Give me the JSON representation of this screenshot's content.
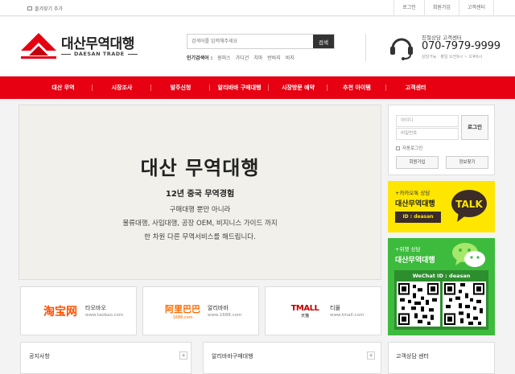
{
  "topbar": {
    "favorite": "즐겨찾기 추가",
    "links": [
      "로그인",
      "회원가입",
      "고객센터"
    ]
  },
  "logo": {
    "name": "대산무역대행",
    "sub": "DAESAN TRADE"
  },
  "search": {
    "placeholder": "검색어를 입력해주세요",
    "button": "검색",
    "popular_label": "인기검색어 :",
    "popular": [
      "원피스",
      "가디건",
      "치마",
      "반바지",
      "바지"
    ]
  },
  "cs": {
    "title": "친절상담 고객센터",
    "phone": "070-7979-9999",
    "hours": "상담가능 : 평일 오전9시 ~ 오후6시"
  },
  "nav": [
    "대산 무역",
    "시장조사",
    "발주신청",
    "알리바바 구매대행",
    "시장방문 예약",
    "추천 아이템",
    "고객센터"
  ],
  "hero": {
    "title": "대산 무역대행",
    "years": "12년 중국 무역경험",
    "line1": "구매대행 뿐만 아니라",
    "line2": "물류대행, 사입대행, 공장 OEM, 비지니스 가이드 까지",
    "line3": "한 차원 다른 무역서비스를 해드립니다."
  },
  "login": {
    "id_placeholder": "아이디",
    "pw_placeholder": "비밀번호",
    "login_button": "로그인",
    "auto_login": "자동로그인",
    "join": "회원가입",
    "find": "정보찾기"
  },
  "kakao": {
    "label": "+카카오톡 상담",
    "title": "대산무역대행",
    "id": "ID : deasan",
    "bubble": "TALK"
  },
  "wechat": {
    "label": "+위챗 상담",
    "title": "대산무역대행",
    "id": "WeChat ID : deasan"
  },
  "partners": [
    {
      "logo": "淘宝网",
      "name": "타오바오",
      "url": "www.taobao.com"
    },
    {
      "logo": "阿里巴巴",
      "logo_sub": "1688.com",
      "name": "알리바바",
      "url": "www.1688.com"
    },
    {
      "logo": "TMALL",
      "logo_sub": "天猫",
      "name": "티몰",
      "url": "www.tmall.com"
    }
  ],
  "boards": {
    "notice": "공지사항",
    "alibaba": "알리바바구매대행",
    "consult": "고객상담 센터",
    "plus": "+"
  },
  "colors": {
    "brand": "#e60012",
    "kakao": "#ffe600",
    "wechat": "#3dbb3d"
  }
}
